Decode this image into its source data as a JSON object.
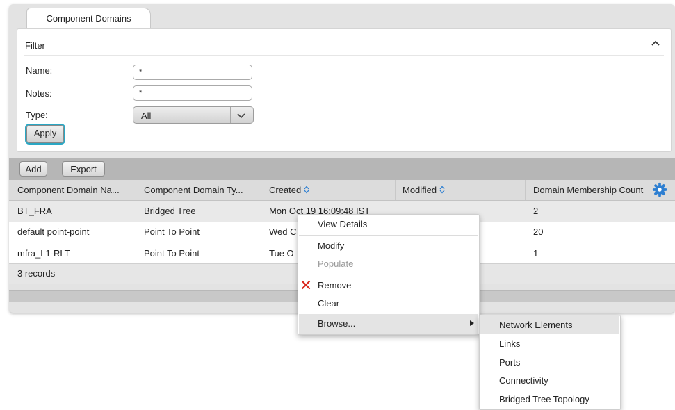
{
  "tab": {
    "label": "Component Domains"
  },
  "filter": {
    "title": "Filter",
    "name_label": "Name:",
    "name_value": "*",
    "notes_label": "Notes:",
    "notes_value": "*",
    "type_label": "Type:",
    "type_value": "All",
    "apply_label": "Apply"
  },
  "toolbar": {
    "add_label": "Add",
    "export_label": "Export"
  },
  "table": {
    "columns": [
      "Component Domain Na...",
      "Component Domain Ty...",
      "Created",
      "Modified",
      "Domain Membership Count"
    ],
    "rows": [
      {
        "name": "BT_FRA",
        "type": "Bridged Tree",
        "created": "Mon Oct 19 16:09:48 IST",
        "modified": "",
        "count": "2"
      },
      {
        "name": "default point-point",
        "type": "Point To Point",
        "created": "Wed C",
        "modified": "",
        "count": "20"
      },
      {
        "name": "mfra_L1-RLT",
        "type": "Point To Point",
        "created": "Tue O",
        "modified": "",
        "count": "1"
      }
    ],
    "records_text": "3 records"
  },
  "context_menu": {
    "items": [
      "View Details",
      "Modify",
      "Populate",
      "Remove",
      "Clear",
      "Browse..."
    ]
  },
  "browse_submenu": {
    "items": [
      "Network Elements",
      "Links",
      "Ports",
      "Connectivity",
      "Bridged Tree Topology"
    ]
  },
  "colors": {
    "accent_focus": "#2aa7c4",
    "gear": "#2e7fd1",
    "remove_icon": "#d9261c"
  }
}
